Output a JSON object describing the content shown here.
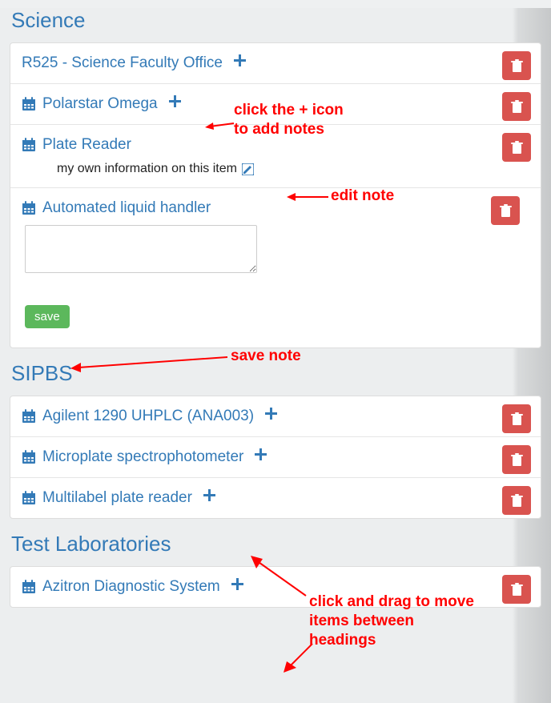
{
  "sections": [
    {
      "title": "Science",
      "items": [
        {
          "label": "R525 - Science Faculty Office",
          "has_cal": false
        },
        {
          "label": "Polarstar Omega",
          "has_cal": true
        },
        {
          "label": "Plate Reader",
          "has_cal": true,
          "note_text": "my own information on this item"
        },
        {
          "label": "Automated liquid handler",
          "has_cal": true,
          "textarea": true,
          "save_label": "save"
        }
      ]
    },
    {
      "title": "SIPBS",
      "items": [
        {
          "label": "Agilent 1290 UHPLC (ANA003)",
          "has_cal": true
        },
        {
          "label": "Microplate spectrophotometer",
          "has_cal": true
        },
        {
          "label": "Multilabel plate reader",
          "has_cal": true
        }
      ]
    },
    {
      "title": "Test Laboratories",
      "items": [
        {
          "label": "Azitron Diagnostic System",
          "has_cal": true
        }
      ]
    }
  ],
  "annotations": {
    "add_notes": "click the + icon\nto add notes",
    "edit_note": "edit note",
    "save_note": "save note",
    "drag": "click and drag to move\nitems between\nheadings"
  }
}
